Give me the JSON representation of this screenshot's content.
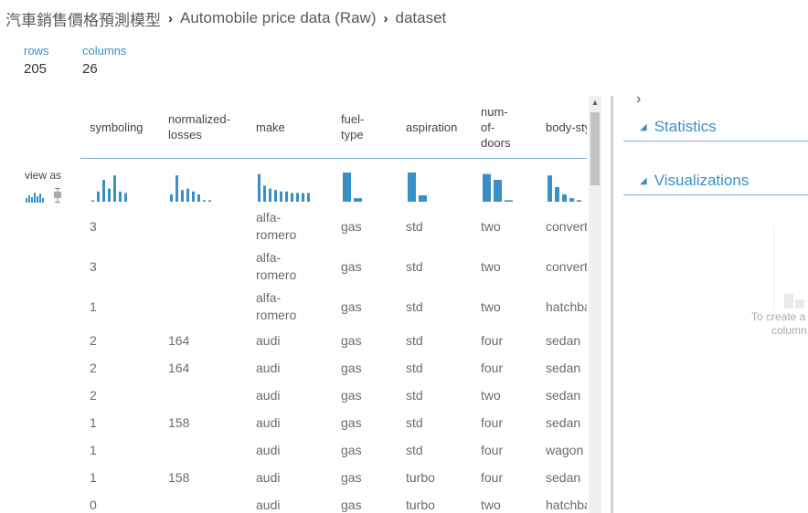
{
  "breadcrumb": {
    "experiment": "汽車銷售價格預測模型",
    "module": "Automobile price data (Raw)",
    "port": "dataset"
  },
  "summary": {
    "rows_label": "rows",
    "rows_value": "205",
    "columns_label": "columns",
    "columns_value": "26"
  },
  "view_as": {
    "label": "view as"
  },
  "columns": [
    "symboling",
    "normalized-\nlosses",
    "make",
    "fuel-\ntype",
    "aspiration",
    "num-\nof-\ndoors",
    "body-style"
  ],
  "rows": [
    [
      "3",
      "",
      "alfa-\nromero",
      "gas",
      "std",
      "two",
      "convertible"
    ],
    [
      "3",
      "",
      "alfa-\nromero",
      "gas",
      "std",
      "two",
      "convertible"
    ],
    [
      "1",
      "",
      "alfa-\nromero",
      "gas",
      "std",
      "two",
      "hatchback"
    ],
    [
      "2",
      "164",
      "audi",
      "gas",
      "std",
      "four",
      "sedan"
    ],
    [
      "2",
      "164",
      "audi",
      "gas",
      "std",
      "four",
      "sedan"
    ],
    [
      "2",
      "",
      "audi",
      "gas",
      "std",
      "two",
      "sedan"
    ],
    [
      "1",
      "158",
      "audi",
      "gas",
      "std",
      "four",
      "sedan"
    ],
    [
      "1",
      "",
      "audi",
      "gas",
      "std",
      "four",
      "wagon"
    ],
    [
      "1",
      "158",
      "audi",
      "gas",
      "turbo",
      "four",
      "sedan"
    ],
    [
      "0",
      "",
      "audi",
      "gas",
      "turbo",
      "two",
      "hatchback"
    ]
  ],
  "histograms": [
    [
      0.05,
      0.35,
      0.75,
      0.45,
      0.9,
      0.35,
      0.3
    ],
    [
      0.25,
      0.9,
      0.4,
      0.45,
      0.35,
      0.25,
      0.05,
      0.05
    ],
    [
      0.95,
      0.55,
      0.45,
      0.4,
      0.35,
      0.35,
      0.3,
      0.3,
      0.3,
      0.3
    ],
    [
      1.0,
      0.12
    ],
    [
      1.0,
      0.22
    ],
    [
      0.95,
      0.75,
      0.05
    ],
    [
      0.9,
      0.5,
      0.25,
      0.12,
      0.05
    ]
  ],
  "panel": {
    "statistics": "Statistics",
    "visualizations": "Visualizations",
    "hint_line1": "To create a",
    "hint_line2": "column"
  },
  "colors": {
    "accent": "#3a8fc6",
    "bar": "#3a8fc6",
    "divider": "#7ab0d2"
  },
  "icons": {
    "breadcrumb_sep": "chevron-right-icon",
    "histogram": "histogram-icon",
    "boxplot": "boxplot-icon",
    "collapse": "triangle-icon"
  }
}
